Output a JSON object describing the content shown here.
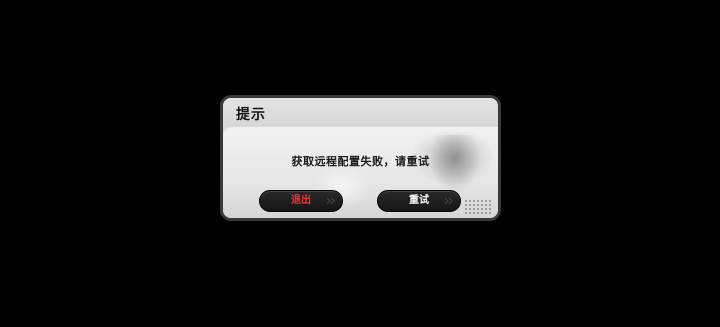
{
  "dialog": {
    "title": "提示",
    "message": "获取远程配置失败，请重试",
    "buttons": {
      "exit_label": "退出",
      "retry_label": "重试"
    }
  },
  "colors": {
    "background": "#000000",
    "dialog_border": "#3a3a3a",
    "button_bg": "#1c1c1c",
    "exit_text": "#e03a3a",
    "retry_text": "#ffffff"
  },
  "icons": {
    "button_decoration": "double-chevron-right-icon"
  }
}
